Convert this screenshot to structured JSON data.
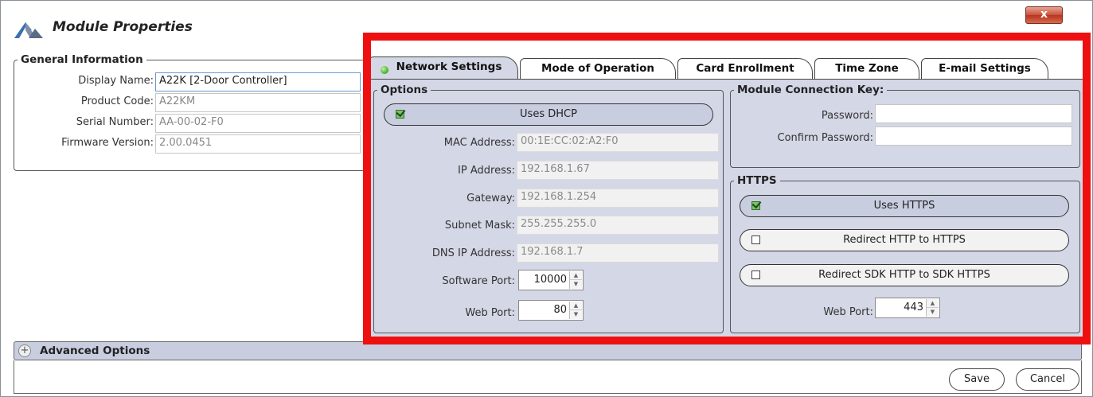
{
  "window": {
    "title": "Module Properties",
    "close_label": "x"
  },
  "general": {
    "legend": "General Information",
    "fields": [
      {
        "label": "Display Name:",
        "value": "A22K [2-Door Controller]"
      },
      {
        "label": "Product Code:",
        "value": "A22KM"
      },
      {
        "label": "Serial Number:",
        "value": "AA-00-02-F0"
      },
      {
        "label": "Firmware Version:",
        "value": "2.00.0451"
      }
    ]
  },
  "tabs": [
    {
      "label": "Network Settings",
      "active": true
    },
    {
      "label": "Mode of Operation",
      "active": false
    },
    {
      "label": "Card Enrollment",
      "active": false
    },
    {
      "label": "Time Zone",
      "active": false
    },
    {
      "label": "E-mail Settings",
      "active": false
    }
  ],
  "options": {
    "legend": "Options",
    "dhcp": {
      "label": "Uses DHCP",
      "checked": true
    },
    "fields": [
      {
        "label": "MAC Address:",
        "value": "00:1E:CC:02:A2:F0"
      },
      {
        "label": "IP Address:",
        "value": "192.168.1.67"
      },
      {
        "label": "Gateway:",
        "value": "192.168.1.254"
      },
      {
        "label": "Subnet Mask:",
        "value": "255.255.255.0"
      },
      {
        "label": "DNS IP Address:",
        "value": "192.168.1.7"
      }
    ],
    "software_port": {
      "label": "Software Port:",
      "value": "10000"
    },
    "web_port": {
      "label": "Web Port:",
      "value": "80"
    }
  },
  "connection_key": {
    "legend": "Module Connection Key:",
    "password_label": "Password:",
    "password_value": "",
    "confirm_label": "Confirm Password:",
    "confirm_value": ""
  },
  "https": {
    "legend": "HTTPS",
    "uses_https": {
      "label": "Uses HTTPS",
      "checked": true
    },
    "redirect_http": {
      "label": "Redirect HTTP to HTTPS",
      "checked": false
    },
    "redirect_sdk": {
      "label": "Redirect SDK HTTP to SDK HTTPS",
      "checked": false
    },
    "web_port": {
      "label": "Web Port:",
      "value": "443"
    }
  },
  "advanced": {
    "label": "Advanced Options",
    "expander": "+"
  },
  "footer": {
    "save_label": "Save",
    "cancel_label": "Cancel"
  },
  "colors": {
    "highlight_frame": "#ee1010",
    "panel_background": "#d4d7e6",
    "toggle_on": "#c9cde0",
    "status_dot": "#3cae2a"
  }
}
